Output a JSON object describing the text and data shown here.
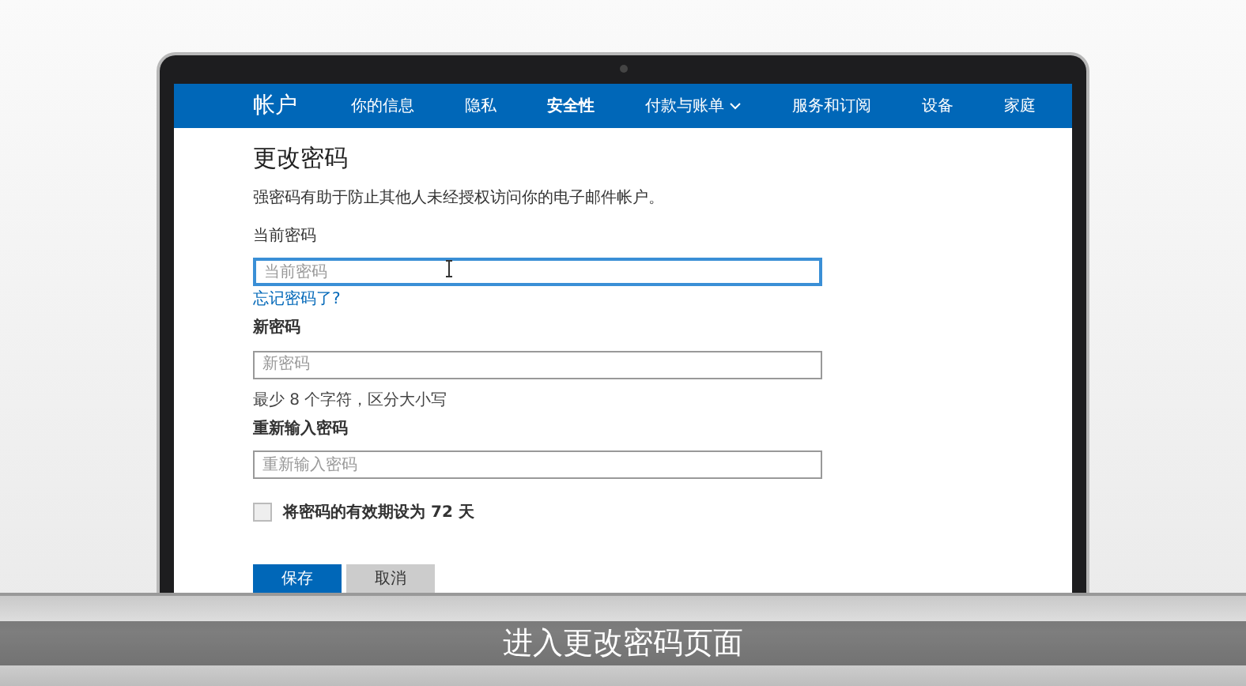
{
  "nav": {
    "brand": "帐户",
    "items": [
      {
        "label": "你的信息",
        "selected": false,
        "has_menu": false
      },
      {
        "label": "隐私",
        "selected": false,
        "has_menu": false
      },
      {
        "label": "安全性",
        "selected": true,
        "has_menu": false
      },
      {
        "label": "付款与账单",
        "selected": false,
        "has_menu": true
      },
      {
        "label": "服务和订阅",
        "selected": false,
        "has_menu": false
      },
      {
        "label": "设备",
        "selected": false,
        "has_menu": false
      },
      {
        "label": "家庭",
        "selected": false,
        "has_menu": false
      }
    ]
  },
  "page": {
    "title": "更改密码",
    "intro": "强密码有助于防止其他人未经授权访问你的电子邮件帐户。",
    "fields": [
      {
        "label": "当前密码",
        "bold": false,
        "placeholder": "当前密码",
        "focused": true,
        "link": "忘记密码了?"
      },
      {
        "label": "新密码",
        "bold": true,
        "placeholder": "新密码",
        "focused": false,
        "hint": "最少 8 个字符，区分大小写"
      },
      {
        "label": "重新输入密码",
        "bold": true,
        "placeholder": "重新输入密码",
        "focused": false
      }
    ],
    "expiry": {
      "label": "将密码的有效期设为 72 天",
      "checked": false
    },
    "buttons": [
      {
        "label": "保存",
        "kind": "primary"
      },
      {
        "label": "取消",
        "kind": "secondary"
      }
    ]
  },
  "caption": "进入更改密码页面"
}
